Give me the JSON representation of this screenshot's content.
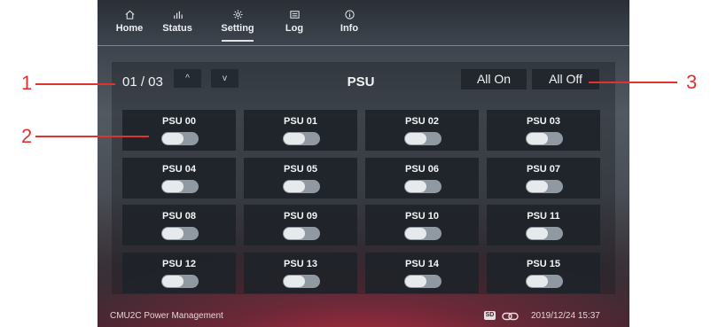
{
  "navbar": {
    "items": [
      {
        "label": "Home",
        "icon": "home-icon"
      },
      {
        "label": "Status",
        "icon": "bar-chart-icon"
      },
      {
        "label": "Setting",
        "icon": "gear-icon",
        "active": true
      },
      {
        "label": "Log",
        "icon": "log-icon"
      },
      {
        "label": "Info",
        "icon": "info-icon"
      }
    ]
  },
  "panel": {
    "page_indicator": "01 / 03",
    "prev_label": "^",
    "next_label": "v",
    "title": "PSU",
    "all_on_label": "All On",
    "all_off_label": "All Off"
  },
  "psus": [
    {
      "label": "PSU 00",
      "on": false
    },
    {
      "label": "PSU 01",
      "on": false
    },
    {
      "label": "PSU 02",
      "on": false
    },
    {
      "label": "PSU 03",
      "on": false
    },
    {
      "label": "PSU 04",
      "on": false
    },
    {
      "label": "PSU 05",
      "on": false
    },
    {
      "label": "PSU 06",
      "on": false
    },
    {
      "label": "PSU 07",
      "on": false
    },
    {
      "label": "PSU 08",
      "on": false
    },
    {
      "label": "PSU 09",
      "on": false
    },
    {
      "label": "PSU 10",
      "on": false
    },
    {
      "label": "PSU 11",
      "on": false
    },
    {
      "label": "PSU 12",
      "on": false
    },
    {
      "label": "PSU 13",
      "on": false
    },
    {
      "label": "PSU 14",
      "on": false
    },
    {
      "label": "PSU 15",
      "on": false
    }
  ],
  "footer": {
    "title": "CMU2C Power Management",
    "sd_label": "SD",
    "datetime": "2019/12/24 15:37"
  },
  "callouts": [
    "1",
    "2",
    "3"
  ],
  "colors": {
    "callout": "#e0332f",
    "tile": "#1e2329",
    "toggle_off": "#9098a1"
  }
}
